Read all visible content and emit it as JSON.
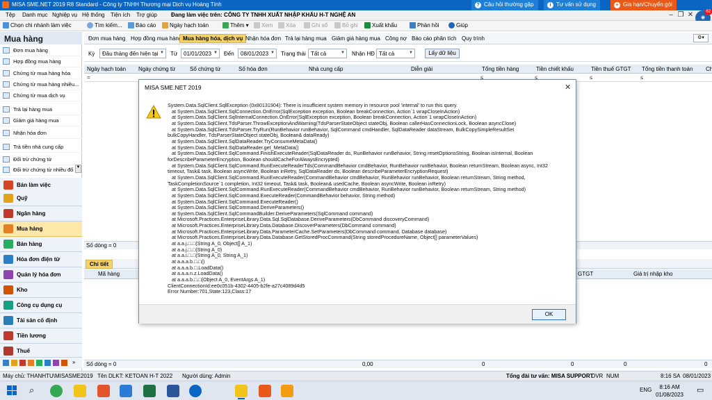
{
  "window": {
    "title": "MISA SME.NET 2019 R8 Standard - Công ty TNHH Thương mại Dịch vụ Hoàng Tính",
    "top_buttons": [
      "Câu hỏi thường gặp",
      "Tư vấn sử dụng",
      "Gia hạn/Chuyển gói"
    ]
  },
  "menubar": {
    "items": [
      "Tệp",
      "Danh mục",
      "Nghiệp vụ",
      "Hệ thống",
      "Tiện ích",
      "Trợ giúp"
    ],
    "company_label": "Đang làm việc trên:",
    "company_name": "CÔNG TY TNHH XUẤT NHẬP KHẨU H-T NGHỆ AN",
    "notification_count": "62"
  },
  "toolbar": {
    "items": [
      {
        "label": "Chọn chi nhánh làm việc",
        "enabled": true
      },
      {
        "label": "Tìm kiếm...",
        "enabled": true
      },
      {
        "label": "Báo cáo",
        "enabled": true
      },
      {
        "label": "Ngày hạch toán",
        "enabled": true
      },
      {
        "label": "Thêm",
        "enabled": true
      },
      {
        "label": "Xem",
        "enabled": false
      },
      {
        "label": "Xóa",
        "enabled": false
      },
      {
        "label": "Ghi sổ",
        "enabled": false
      },
      {
        "label": "Bỏ ghi",
        "enabled": false
      },
      {
        "label": "Xuất khẩu",
        "enabled": true
      },
      {
        "label": "Phản hồi",
        "enabled": true
      },
      {
        "label": "Giúp",
        "enabled": true
      }
    ]
  },
  "sidebar": {
    "header": "Mua hàng",
    "items": [
      "Đơn mua hàng",
      "Hợp đồng mua hàng",
      "Chứng từ mua hàng hóa",
      "Chứng từ mua hàng nhiều...",
      "Chứng từ mua dịch vụ",
      "Trả lại hàng mua",
      "Giảm giá hàng mua",
      "Nhận hóa đơn",
      "Trả tiền nhà cung cấp",
      "Đối trừ chứng từ",
      "Đối trừ chứng từ nhiều đối"
    ],
    "modules": [
      "Bán làm việc",
      "Quỹ",
      "Ngân hàng",
      "Mua hàng",
      "Bán hàng",
      "Hóa đơn điện tử",
      "Quản lý hóa đơn",
      "Kho",
      "Công cụ dụng cụ",
      "Tài sản cố định",
      "Tiền lương",
      "Thuế"
    ],
    "active_module": "Mua hàng"
  },
  "tabs": {
    "items": [
      "Đơn mua hàng",
      "Hợp đồng mua hàng",
      "Mua hàng hóa, dịch vụ",
      "Nhận hóa đơn",
      "Trả lại hàng mua",
      "Giảm giá hàng mua",
      "Công nợ",
      "Báo cáo phân tích",
      "Quy trình"
    ],
    "active": "Mua hàng hóa, dịch vụ"
  },
  "filters": {
    "period_label": "Kỳ",
    "period_value": "Đầu tháng đến hiện tại",
    "from_label": "Từ",
    "from_value": "01/01/2023",
    "to_label": "Đến",
    "to_value": "08/01/2023",
    "status_label": "Trạng thái",
    "status_value": "Tất cả",
    "invoice_label": "Nhận HĐ",
    "invoice_value": "Tất cả",
    "fetch_button": "Lấy dữ liệu"
  },
  "grid": {
    "columns": [
      "Ngày hạch toán",
      "Ngày chứng từ",
      "Số chứng từ",
      "Số hóa đơn",
      "Nhà cung cấp",
      "Diễn giải",
      "Tổng tiền hàng",
      "Tiền chiết khấu",
      "Tiền thuế GTGT",
      "Tổng tiền thanh toán",
      "Ch"
    ],
    "filter_symbols": [
      "=",
      "≤",
      "≤",
      "≤",
      "≤"
    ],
    "row_count": "Số dòng = 0"
  },
  "detail": {
    "tab": "Chi tiết",
    "columns_left": "Mã hàng",
    "columns_right": [
      "GTGT",
      "Giá trị nhập kho"
    ],
    "row_count": "Số dòng = 0",
    "totals": [
      "0,00",
      "0",
      "0",
      "0",
      "0"
    ]
  },
  "dialog": {
    "title": "MISA SME.NET 2019",
    "message": "System.Data.SqlClient.SqlException (0x80131904): There is insufficient system memory in resource pool 'internal' to run this query.\n   at System.Data.SqlClient.SqlConnection.OnError(SqlException exception, Boolean breakConnection, Action`1 wrapCloseInAction)\n   at System.Data.SqlClient.SqlInternalConnection.OnError(SqlException exception, Boolean breakConnection, Action`1 wrapCloseInAction)\n   at System.Data.SqlClient.TdsParser.ThrowExceptionAndWarning(TdsParserStateObject stateObj, Boolean callerHasConnectionLock, Boolean asyncClose)\n   at System.Data.SqlClient.TdsParser.TryRun(RunBehavior runBehavior, SqlCommand cmdHandler, SqlDataReader dataStream, BulkCopySimpleResultSet\nbulkCopyHandler, TdsParserStateObject stateObj, Boolean& dataReady)\n   at System.Data.SqlClient.SqlDataReader.TryConsumeMetaData()\n   at System.Data.SqlClient.SqlDataReader.get_MetaData()\n   at System.Data.SqlClient.SqlCommand.FinishExecuteReader(SqlDataReader ds, RunBehavior runBehavior, String resetOptionsString, Boolean isInternal, Boolean\nforDescribeParameterEncryption, Boolean shouldCacheForAlwaysEncrypted)\n   at System.Data.SqlClient.SqlCommand.RunExecuteReaderTds(CommandBehavior cmdBehavior, RunBehavior runBehavior, Boolean returnStream, Boolean async, Int32\ntimeout, Task& task, Boolean asyncWrite, Boolean inRetry, SqlDataReader ds, Boolean describeParameterEncryptionRequest)\n   at System.Data.SqlClient.SqlCommand.RunExecuteReader(CommandBehavior cmdBehavior, RunBehavior runBehavior, Boolean returnStream, String method,\nTaskCompletionSource`1 completion, Int32 timeout, Task& task, Boolean& usedCache, Boolean asyncWrite, Boolean inRetry)\n   at System.Data.SqlClient.SqlCommand.RunExecuteReader(CommandBehavior cmdBehavior, RunBehavior runBehavior, Boolean returnStream, String method)\n   at System.Data.SqlClient.SqlCommand.ExecuteReader(CommandBehavior behavior, String method)\n   at System.Data.SqlClient.SqlCommand.ExecuteReader()\n   at System.Data.SqlClient.SqlCommand.DeriveParameters()\n   at System.Data.SqlClient.SqlCommandBuilder.DeriveParameters(SqlCommand command)\n   at Microsoft.Practices.EnterpriseLibrary.Data.Sql.SqlDatabase.DeriveParameters(DbCommand discoveryCommand)\n   at Microsoft.Practices.EnterpriseLibrary.Data.Database.DiscoverParameters(DbCommand command)\n   at Microsoft.Practices.EnterpriseLibrary.Data.ParameterCache.SetParameters(DbCommand command, Database database)\n   at Microsoft.Practices.EnterpriseLibrary.Data.Database.GetStoredProcCommand(String storedProcedureName, Object[] parameterValues)\n   at a.a.j.□.□(String A_0, Object[] A_1)\n   at a.a.j.□.□(String A_0)\n   at a.a.i.□.□(String A_0, String A_1)\n   at a.a.a.b.□.□()\n   at a.a.a.b.□.LoadData()\n   at a.a.a.n.z.LoadData()\n   at a.a.a.b.□.□(Object A_0, EventArgs A_1)\nClientConnectionId:ee0c051b-4302-4405-b2fe-a27c4089d4d5\nError Number:701,State:123,Class:17",
    "ok_button": "OK",
    "close_glyph": "✕"
  },
  "statusbar": {
    "server": "Máy chủ: THANHTU\\MISASME2019",
    "db": "Tên DLKT: KETOAN H-T 2022",
    "user": "Người dùng: Admin",
    "support": "Tổng đài tư vấn: MISA SUPPORT",
    "ovr": "OVR",
    "num": "NUM",
    "time": "8:16 SA",
    "date": "08/01/2023"
  },
  "taskbar": {
    "lang": "ENG",
    "clock_time": "8:16 AM",
    "clock_date": "01/08/2023"
  }
}
